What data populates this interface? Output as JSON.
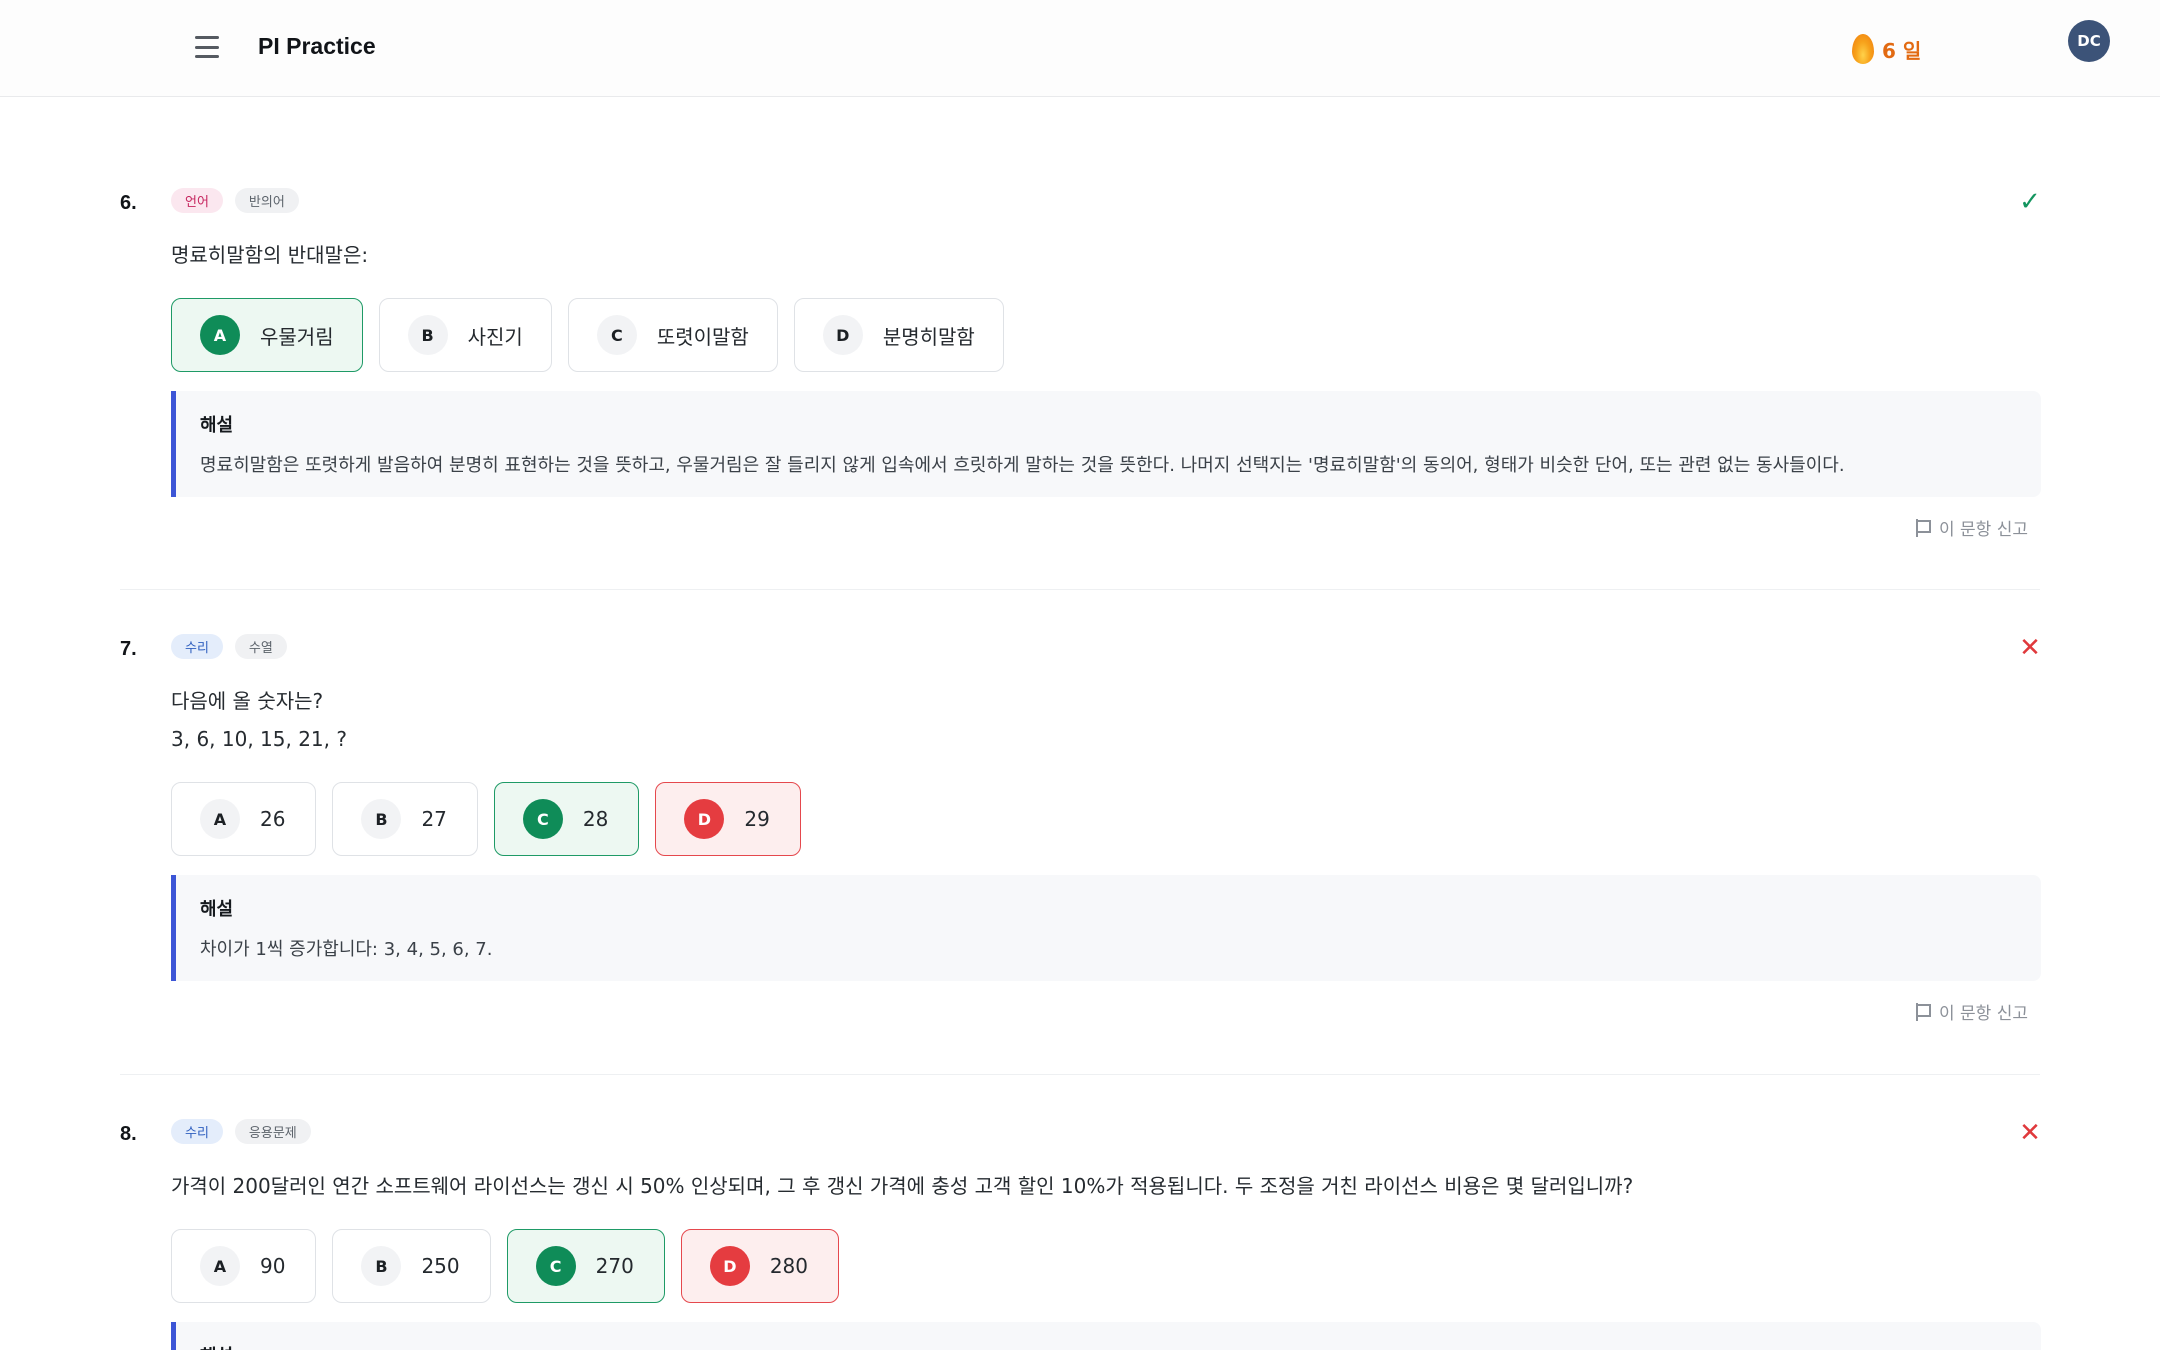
{
  "header": {
    "app_title": "PI Practice",
    "streak": "6 일",
    "avatar_initials": "DC"
  },
  "questions": [
    {
      "number": "6.",
      "tags": [
        "언어",
        "반의어"
      ],
      "status": "correct",
      "prompt_lines": [
        "명료히말함의 반대말은:"
      ],
      "options": [
        {
          "letter": "A",
          "text": "우물거림",
          "state": "correct"
        },
        {
          "letter": "B",
          "text": "사진기",
          "state": "none"
        },
        {
          "letter": "C",
          "text": "또렷이말함",
          "state": "none"
        },
        {
          "letter": "D",
          "text": "분명히말함",
          "state": "none"
        }
      ],
      "explanation_title": "해설",
      "explanation": "명료히말함은 또렷하게 발음하여 분명히 표현하는 것을 뜻하고, 우물거림은 잘 들리지 않게 입속에서 흐릿하게 말하는 것을 뜻한다. 나머지 선택지는 '명료히말함'의 동의어, 형태가 비슷한 단어, 또는 관련 없는 동사들이다.",
      "report_label": "이 문항 신고"
    },
    {
      "number": "7.",
      "tags": [
        "수리",
        "수열"
      ],
      "status": "incorrect",
      "prompt_lines": [
        "다음에 올 숫자는?",
        "3, 6, 10, 15, 21, ?"
      ],
      "options": [
        {
          "letter": "A",
          "text": "26",
          "state": "none"
        },
        {
          "letter": "B",
          "text": "27",
          "state": "none"
        },
        {
          "letter": "C",
          "text": "28",
          "state": "correct"
        },
        {
          "letter": "D",
          "text": "29",
          "state": "wrong"
        }
      ],
      "explanation_title": "해설",
      "explanation": "차이가 1씩 증가합니다: 3, 4, 5, 6, 7.",
      "report_label": "이 문항 신고"
    },
    {
      "number": "8.",
      "tags": [
        "수리",
        "응용문제"
      ],
      "status": "incorrect",
      "prompt_lines": [
        "가격이 200달러인 연간 소프트웨어 라이선스는 갱신 시 50% 인상되며, 그 후 갱신 가격에 충성 고객 할인 10%가 적용됩니다. 두 조정을 거친 라이선스 비용은 몇 달러입니까?"
      ],
      "options": [
        {
          "letter": "A",
          "text": "90",
          "state": "none"
        },
        {
          "letter": "B",
          "text": "250",
          "state": "none"
        },
        {
          "letter": "C",
          "text": "270",
          "state": "correct"
        },
        {
          "letter": "D",
          "text": "280",
          "state": "wrong"
        }
      ],
      "explanation_title": "해설"
    }
  ],
  "icons": {
    "correct": "✓",
    "incorrect": "✕"
  },
  "colors": {
    "correct": "#0f8c58",
    "wrong": "#e53c40",
    "accent": "#3c55d6",
    "streak": "#e26a12"
  }
}
